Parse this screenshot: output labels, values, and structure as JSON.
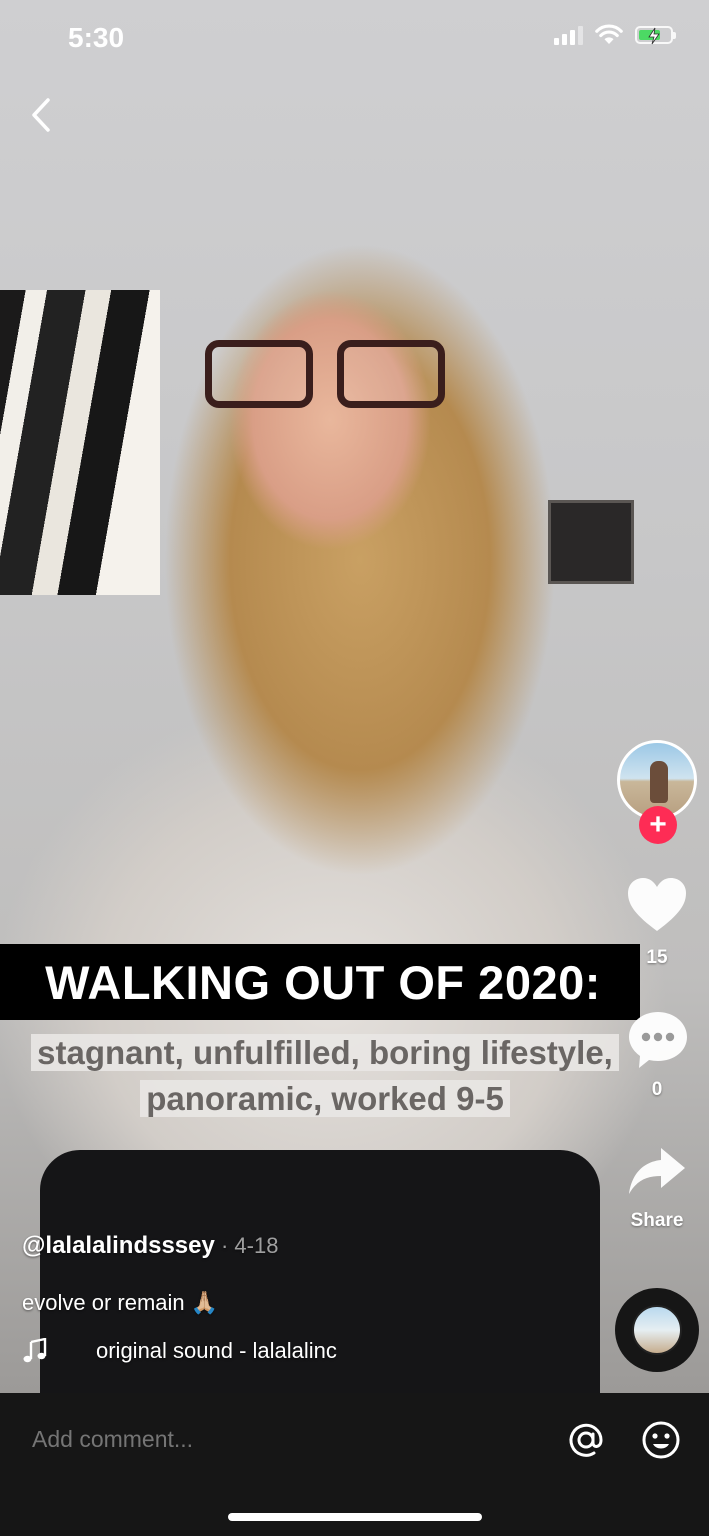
{
  "status_bar": {
    "time": "5:30"
  },
  "video": {
    "overlay_title": "WALKING OUT OF 2020:",
    "overlay_subtitle_line1": "stagnant, unfulfilled, boring lifestyle,",
    "overlay_subtitle_line2": "panoramic, worked 9-5"
  },
  "actions": {
    "likes_count": "15",
    "comments_count": "0",
    "share_label": "Share"
  },
  "post": {
    "author": "@lalalalindsssey",
    "date": " · 4-18",
    "caption": "evolve or remain 🙏🏼",
    "sound": "original sound - lalalalinc"
  },
  "comment_bar": {
    "placeholder": "Add comment..."
  },
  "colors": {
    "follow_accent": "#fe2c55",
    "comment_bar_bg": "#161616"
  }
}
